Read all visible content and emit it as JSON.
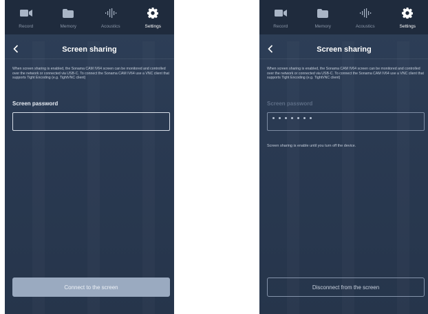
{
  "tabs": [
    {
      "label": "Record",
      "icon": "camera-icon"
    },
    {
      "label": "Memory",
      "icon": "folder-icon"
    },
    {
      "label": "Acoustics",
      "icon": "waveform-icon"
    },
    {
      "label": "Settings",
      "icon": "gear-icon",
      "active": true
    }
  ],
  "page_title": "Screen sharing",
  "description": "When screen sharing is enabled, the Sonama CAM IV64 screen can be monitored and controlled over the network or connected via USB-C. To connect the Sonama CAM IV64 use a VNC client that supports Tight Encoding (e.g. TightVNC client)",
  "password_label": "Screen password",
  "left_screen": {
    "password_value": "",
    "button_label": "Connect to the screen"
  },
  "right_screen": {
    "password_value": "•••••••",
    "note": "Screen sharing is enable until you turn off the device.",
    "button_label": "Disconnect from the screen"
  },
  "colors": {
    "background": "#2a3a52",
    "tabbar": "#1f2b3d",
    "button_filled": "#9aaac0"
  }
}
